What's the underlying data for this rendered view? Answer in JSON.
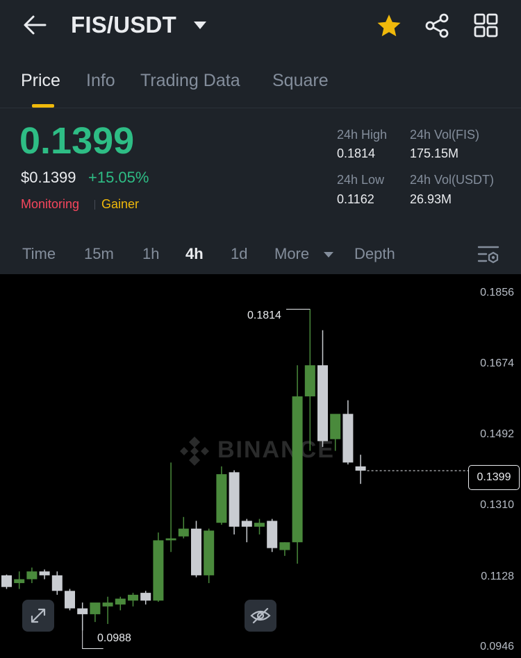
{
  "header": {
    "pair": "FIS/USDT",
    "icons": [
      "back-arrow-icon",
      "dropdown-caret-icon",
      "star-icon",
      "share-icon",
      "grid-icon"
    ],
    "favorited": true
  },
  "tabs": [
    {
      "label": "Price",
      "active": true
    },
    {
      "label": "Info",
      "active": false
    },
    {
      "label": "Trading Data",
      "active": false
    },
    {
      "label": "Square",
      "active": false
    }
  ],
  "ticker": {
    "last_price": "0.1399",
    "usd_price": "$0.1399",
    "change": "+15.05%",
    "tag_monitoring": "Monitoring",
    "tag_gainer": "Gainer",
    "high_label": "24h High",
    "high": "0.1814",
    "low_label": "24h Low",
    "low": "0.1162",
    "vol_base_label": "24h Vol(FIS)",
    "vol_base": "175.15M",
    "vol_quote_label": "24h Vol(USDT)",
    "vol_quote": "26.93M"
  },
  "intervals": {
    "items": [
      {
        "label": "Time",
        "active": false
      },
      {
        "label": "15m",
        "active": false
      },
      {
        "label": "1h",
        "active": false
      },
      {
        "label": "4h",
        "active": true
      },
      {
        "label": "1d",
        "active": false
      },
      {
        "label": "More",
        "active": false
      },
      {
        "label": "Depth",
        "active": false
      }
    ]
  },
  "colors": {
    "up": "#2ebd85",
    "candle_up": "#4a8a3c",
    "candle_down": "#c9ccd1",
    "accent": "#f0b90b",
    "down_tag": "#f6465d"
  },
  "chart": {
    "watermark": "BINANCE",
    "current_price": "0.1399",
    "high_marker": "0.1814",
    "low_marker": "0.0988",
    "y_ticks": [
      "0.1856",
      "0.1674",
      "0.1492",
      "0.1310",
      "0.1128",
      "0.0946"
    ]
  },
  "chart_data": {
    "type": "candlestick",
    "interval": "4h",
    "ylim": [
      0.0946,
      0.1856
    ],
    "candles": [
      {
        "o": 0.113,
        "h": 0.1132,
        "l": 0.1095,
        "c": 0.11
      },
      {
        "o": 0.111,
        "h": 0.114,
        "l": 0.1095,
        "c": 0.112
      },
      {
        "o": 0.112,
        "h": 0.115,
        "l": 0.111,
        "c": 0.114
      },
      {
        "o": 0.114,
        "h": 0.1145,
        "l": 0.112,
        "c": 0.113
      },
      {
        "o": 0.113,
        "h": 0.114,
        "l": 0.108,
        "c": 0.109
      },
      {
        "o": 0.109,
        "h": 0.1095,
        "l": 0.104,
        "c": 0.1045
      },
      {
        "o": 0.1045,
        "h": 0.106,
        "l": 0.0988,
        "c": 0.103
      },
      {
        "o": 0.103,
        "h": 0.1035,
        "l": 0.101,
        "c": 0.106
      },
      {
        "o": 0.105,
        "h": 0.1075,
        "l": 0.1005,
        "c": 0.106
      },
      {
        "o": 0.1055,
        "h": 0.1075,
        "l": 0.104,
        "c": 0.107
      },
      {
        "o": 0.1065,
        "h": 0.1085,
        "l": 0.105,
        "c": 0.108
      },
      {
        "o": 0.1085,
        "h": 0.109,
        "l": 0.1055,
        "c": 0.1065
      },
      {
        "o": 0.1065,
        "h": 0.124,
        "l": 0.1062,
        "c": 0.122
      },
      {
        "o": 0.122,
        "h": 0.142,
        "l": 0.119,
        "c": 0.1225
      },
      {
        "o": 0.123,
        "h": 0.128,
        "l": 0.1225,
        "c": 0.125
      },
      {
        "o": 0.125,
        "h": 0.127,
        "l": 0.1125,
        "c": 0.113
      },
      {
        "o": 0.113,
        "h": 0.125,
        "l": 0.111,
        "c": 0.1245
      },
      {
        "o": 0.1265,
        "h": 0.141,
        "l": 0.126,
        "c": 0.139
      },
      {
        "o": 0.1395,
        "h": 0.14,
        "l": 0.1235,
        "c": 0.1255
      },
      {
        "o": 0.127,
        "h": 0.1275,
        "l": 0.1215,
        "c": 0.1255
      },
      {
        "o": 0.1255,
        "h": 0.1275,
        "l": 0.1235,
        "c": 0.1265
      },
      {
        "o": 0.127,
        "h": 0.1275,
        "l": 0.119,
        "c": 0.12
      },
      {
        "o": 0.1195,
        "h": 0.1215,
        "l": 0.118,
        "c": 0.1215
      },
      {
        "o": 0.1215,
        "h": 0.167,
        "l": 0.116,
        "c": 0.159
      },
      {
        "o": 0.159,
        "h": 0.1814,
        "l": 0.145,
        "c": 0.167
      },
      {
        "o": 0.167,
        "h": 0.176,
        "l": 0.146,
        "c": 0.1475
      },
      {
        "o": 0.148,
        "h": 0.154,
        "l": 0.145,
        "c": 0.1545
      },
      {
        "o": 0.1545,
        "h": 0.158,
        "l": 0.1415,
        "c": 0.142
      },
      {
        "o": 0.141,
        "h": 0.144,
        "l": 0.1365,
        "c": 0.1399
      }
    ]
  }
}
